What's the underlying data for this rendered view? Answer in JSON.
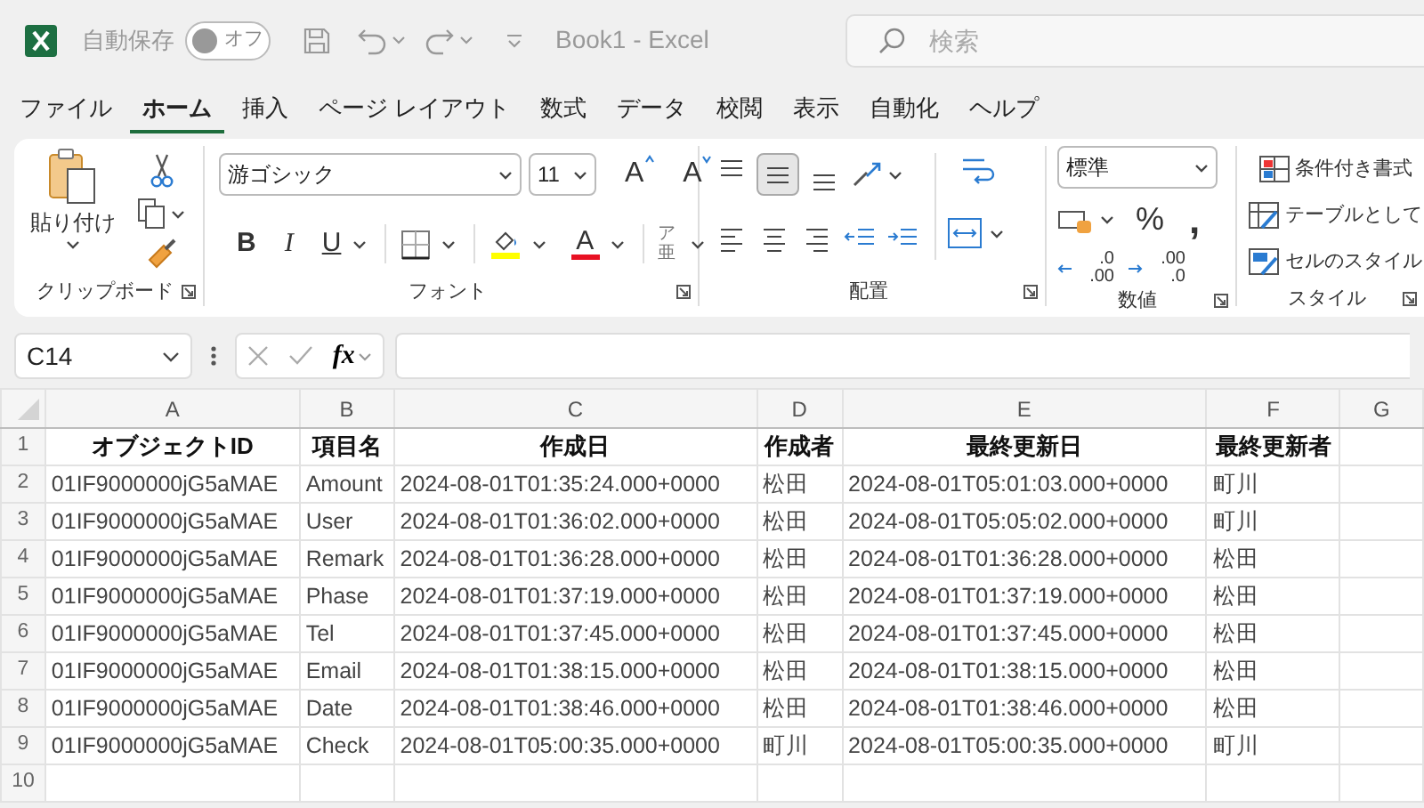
{
  "title_bar": {
    "autosave_label": "自動保存",
    "autosave": {
      "on": false,
      "label": "オフ"
    },
    "title": "Book1 - Excel",
    "search": {
      "placeholder": "検索"
    }
  },
  "tabs": [
    {
      "label": "ファイル",
      "selected": false
    },
    {
      "label": "ホーム",
      "selected": true
    },
    {
      "label": "挿入",
      "selected": false
    },
    {
      "label": "ページ レイアウト",
      "selected": false
    },
    {
      "label": "数式",
      "selected": false
    },
    {
      "label": "データ",
      "selected": false
    },
    {
      "label": "校閲",
      "selected": false
    },
    {
      "label": "表示",
      "selected": false
    },
    {
      "label": "自動化",
      "selected": false
    },
    {
      "label": "ヘルプ",
      "selected": false
    }
  ],
  "ribbon": {
    "clipboard": {
      "paste": "貼り付け",
      "label": "クリップボード"
    },
    "font": {
      "font_name": "游ゴシック",
      "font_size": "11",
      "grow": "A",
      "shrink": "A",
      "bold": "B",
      "italic": "I",
      "underline": "U",
      "font_color": "A",
      "phonetic": "ア亜",
      "label": "フォント"
    },
    "alignment": {
      "vertical_buttons": [
        {
          "kind": "top",
          "selected": false
        },
        {
          "kind": "middle",
          "selected": true
        },
        {
          "kind": "bottom",
          "selected": false
        }
      ],
      "label": "配置"
    },
    "number": {
      "format": "標準",
      "percent": "%",
      "comma": ",",
      "decimals": [
        {
          "top": ".0",
          "bottom": ".00"
        },
        {
          "top": ".00",
          "bottom": ".0"
        }
      ],
      "label": "数値"
    },
    "styles": {
      "items": [
        "条件付き書式",
        "テーブルとして",
        "セルのスタイル"
      ],
      "label": "スタイル"
    }
  },
  "formula_bar": {
    "name_box": "C14",
    "fx": "fx"
  },
  "sheet": {
    "columns": [
      "A",
      "B",
      "C",
      "D",
      "E",
      "F",
      "G"
    ],
    "rows": [
      {
        "number": "1",
        "kind": "header",
        "cells": [
          "オブジェクトID",
          "項目名",
          "作成日",
          "作成者",
          "最終更新日",
          "最終更新者"
        ]
      },
      {
        "number": "2",
        "kind": "data",
        "cells": [
          "01IF9000000jG5aMAE",
          "Amount",
          "2024-08-01T01:35:24.000+0000",
          "松田",
          "2024-08-01T05:01:03.000+0000",
          "町川"
        ]
      },
      {
        "number": "3",
        "kind": "data",
        "cells": [
          "01IF9000000jG5aMAE",
          "User",
          "2024-08-01T01:36:02.000+0000",
          "松田",
          "2024-08-01T05:05:02.000+0000",
          "町川"
        ]
      },
      {
        "number": "4",
        "kind": "data",
        "cells": [
          "01IF9000000jG5aMAE",
          "Remark",
          "2024-08-01T01:36:28.000+0000",
          "松田",
          "2024-08-01T01:36:28.000+0000",
          "松田"
        ]
      },
      {
        "number": "5",
        "kind": "data",
        "cells": [
          "01IF9000000jG5aMAE",
          "Phase",
          "2024-08-01T01:37:19.000+0000",
          "松田",
          "2024-08-01T01:37:19.000+0000",
          "松田"
        ]
      },
      {
        "number": "6",
        "kind": "data",
        "cells": [
          "01IF9000000jG5aMAE",
          "Tel",
          "2024-08-01T01:37:45.000+0000",
          "松田",
          "2024-08-01T01:37:45.000+0000",
          "松田"
        ]
      },
      {
        "number": "7",
        "kind": "data",
        "cells": [
          "01IF9000000jG5aMAE",
          "Email",
          "2024-08-01T01:38:15.000+0000",
          "松田",
          "2024-08-01T01:38:15.000+0000",
          "松田"
        ]
      },
      {
        "number": "8",
        "kind": "data",
        "cells": [
          "01IF9000000jG5aMAE",
          "Date",
          "2024-08-01T01:38:46.000+0000",
          "松田",
          "2024-08-01T01:38:46.000+0000",
          "松田"
        ]
      },
      {
        "number": "9",
        "kind": "data",
        "cells": [
          "01IF9000000jG5aMAE",
          "Check",
          "2024-08-01T05:00:35.000+0000",
          "町川",
          "2024-08-01T05:00:35.000+0000",
          "町川"
        ]
      },
      {
        "number": "10",
        "kind": "empty"
      }
    ]
  }
}
